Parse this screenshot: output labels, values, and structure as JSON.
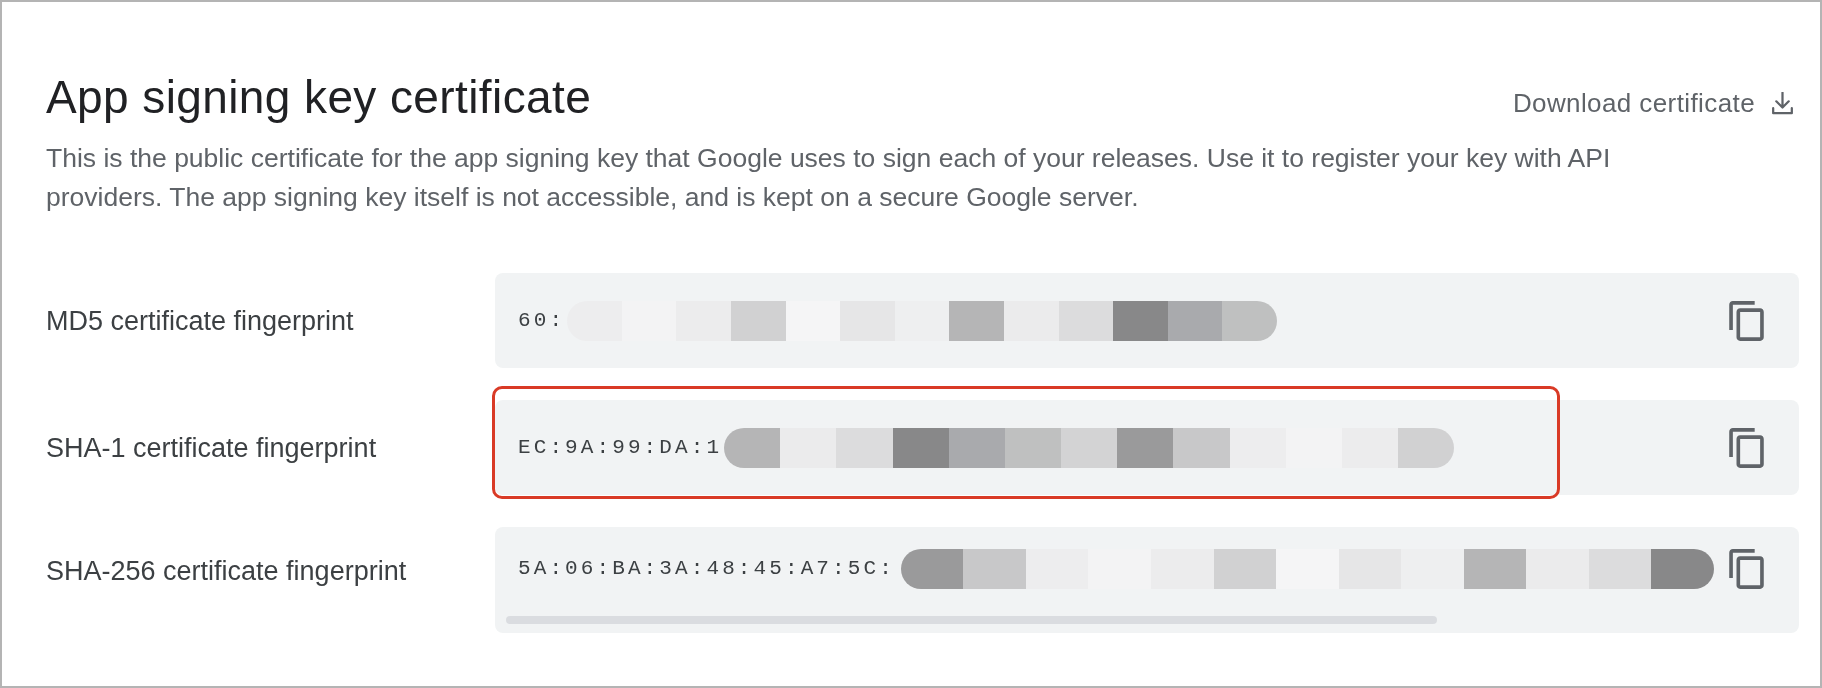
{
  "header": {
    "title": "App signing key certificate",
    "download": {
      "label": "Download certificate"
    },
    "description": "This is the public certificate for the app signing key that Google uses to sign each of your releases. Use it to register your key with API providers. The app signing key itself is not accessible, and is kept on a secure Google server."
  },
  "fingerprints": [
    {
      "label": "MD5 certificate fingerprint",
      "value": "60:",
      "redacted": true,
      "highlighted": false,
      "scrollable": false
    },
    {
      "label": "SHA-1 certificate fingerprint",
      "value": "EC:9A:99:DA:1",
      "redacted": true,
      "highlighted": true,
      "scrollable": false
    },
    {
      "label": "SHA-256 certificate fingerprint",
      "value": "5A:06:BA:3A:48:45:A7:5C:",
      "redacted": true,
      "highlighted": false,
      "scrollable": true
    }
  ]
}
